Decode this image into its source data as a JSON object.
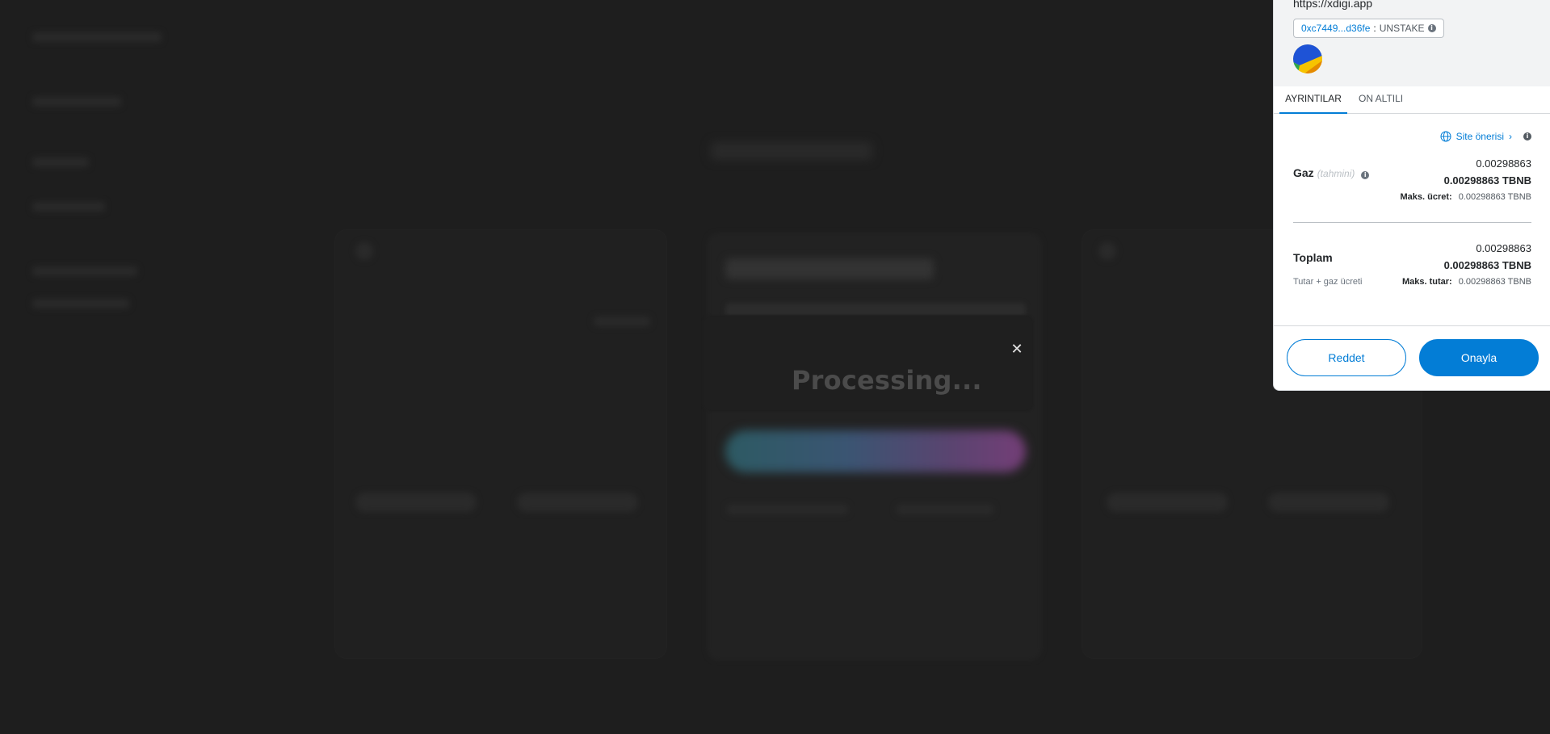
{
  "background": {
    "processing_text": "Processing..."
  },
  "metamask": {
    "site_url": "https://xdigi.app",
    "contract": {
      "address": "0xc7449...d36fe",
      "separator": ":",
      "method": "UNSTAKE"
    },
    "tabs": [
      {
        "label": "AYRINTILAR",
        "active": true
      },
      {
        "label": "ON ALTILI",
        "active": false
      }
    ],
    "site_suggestion": "Site önerisi",
    "gas": {
      "label": "Gaz",
      "estimate_label": "(tahmini)",
      "value": "0.00298863",
      "value_bold": "0.00298863 TBNB",
      "max_label": "Maks. ücret:",
      "max_value": "0.00298863 TBNB"
    },
    "total": {
      "label": "Toplam",
      "sub_label": "Tutar + gaz ücreti",
      "value": "0.00298863",
      "value_bold": "0.00298863 TBNB",
      "max_label": "Maks. tutar:",
      "max_value": "0.00298863 TBNB"
    },
    "buttons": {
      "reject": "Reddet",
      "confirm": "Onayla"
    },
    "colors": {
      "accent": "#037dd6",
      "header_bg": "#f2f3f4"
    }
  }
}
